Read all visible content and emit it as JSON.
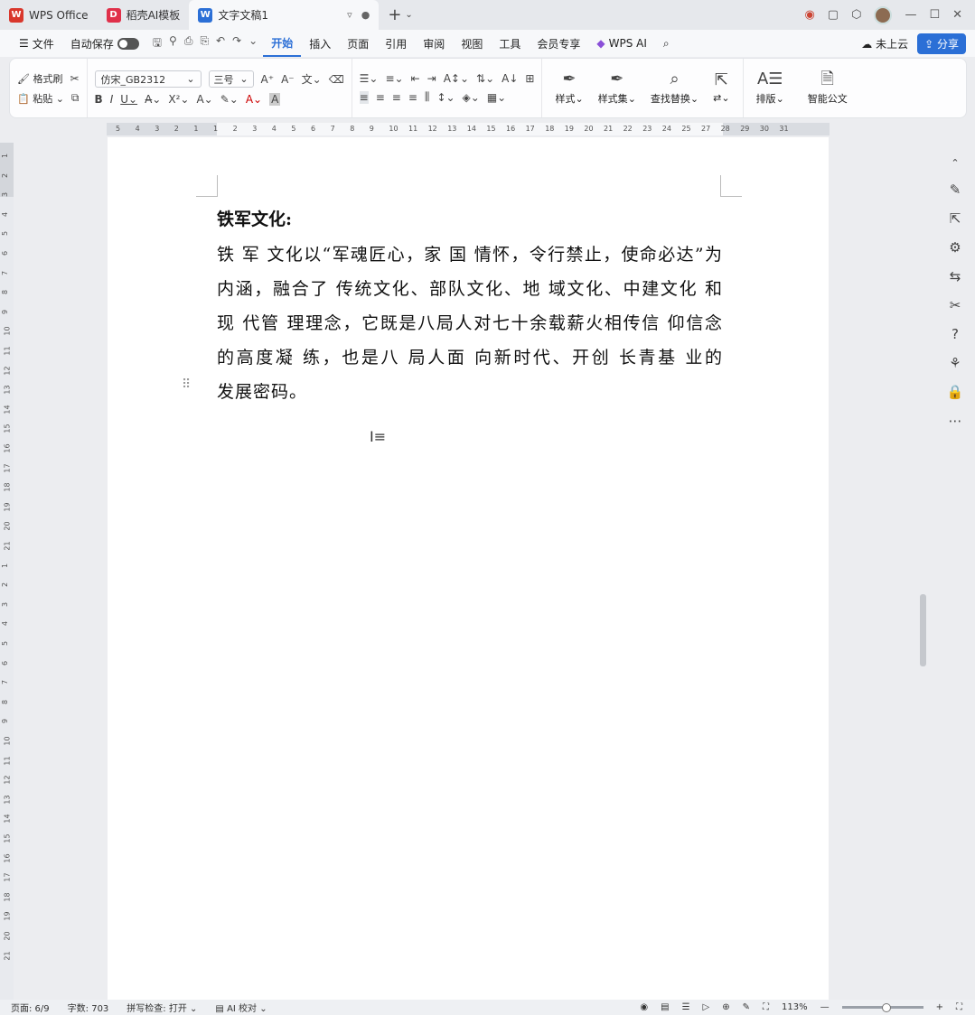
{
  "tabs": [
    {
      "label": "WPS Office",
      "icon": "wps-logo-icon",
      "color": "#d9372c"
    },
    {
      "label": "稻壳AI模板",
      "icon": "docer-logo-icon",
      "color": "#e0304a"
    },
    {
      "label": "文字文稿1",
      "icon": "writer-logo-icon",
      "color": "#2b6fd6"
    }
  ],
  "menu": {
    "file": "文件",
    "autosave": "自动保存",
    "items": [
      "开始",
      "插入",
      "页面",
      "引用",
      "审阅",
      "视图",
      "工具",
      "会员专享"
    ],
    "active": "开始",
    "wps_ai": "WPS AI",
    "cloud": "未上云",
    "share": "分享"
  },
  "ribbon": {
    "format_painter": "格式刷",
    "paste": "粘贴",
    "font_name": "仿宋_GB2312",
    "font_size": "三号",
    "styles": "样式",
    "style_set": "样式集",
    "find_replace": "查找替换",
    "layout": "排版",
    "smart_doc": "智能公文"
  },
  "ruler_h": [
    "5",
    "4",
    "3",
    "2",
    "1",
    "1",
    "2",
    "3",
    "4",
    "5",
    "6",
    "7",
    "8",
    "9",
    "10",
    "11",
    "12",
    "13",
    "14",
    "15",
    "16",
    "17",
    "18",
    "19",
    "20",
    "21",
    "22",
    "23",
    "24",
    "25",
    "27",
    "28",
    "29",
    "30",
    "31"
  ],
  "document": {
    "heading": "铁军文化:",
    "paragraph": "铁 军 文化以“军魂匠心，家 国 情怀，令行禁止，使命必达”为内涵，融合了 传统文化、部队文化、地 域文化、中建文化 和现 代管 理理念，它既是八局人对七十余载薪火相传信 仰信念的高度凝 练，也是八 局人面 向新时代、开创 长青基 业的　　　　　　　　　　　　　发展密码。"
  },
  "status": {
    "page": "页面: 6/9",
    "words": "字数: 703",
    "spellcheck": "拼写检查: 打开",
    "ai_proof": "AI 校对",
    "zoom": "113%"
  },
  "colors": {
    "accent": "#2b6fd6",
    "wps_red": "#d9372c"
  }
}
